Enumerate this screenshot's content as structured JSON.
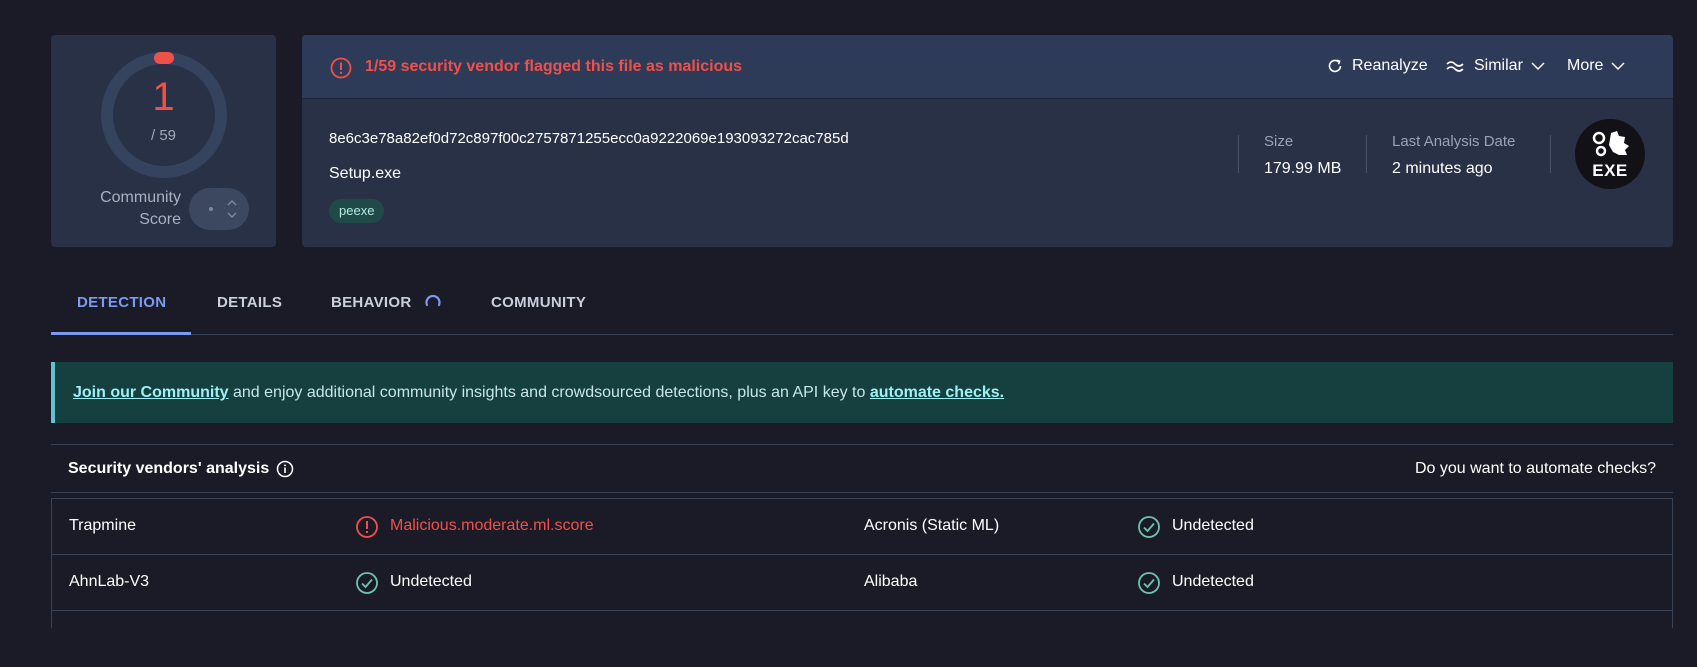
{
  "score": {
    "detections": "1",
    "total": "/ 59",
    "community_label_line1": "Community",
    "community_label_line2": "Score"
  },
  "file": {
    "alert": "1/59 security vendor flagged this file as malicious",
    "hash": "8e6c3e78a82ef0d72c897f00c2757871255ecc0a9222069e193093272cac785d",
    "name": "Setup.exe",
    "tag": "peexe",
    "size_label": "Size",
    "size_value": "179.99 MB",
    "date_label": "Last Analysis Date",
    "date_value": "2 minutes ago",
    "type_badge": "EXE"
  },
  "actions": {
    "reanalyze": "Reanalyze",
    "similar": "Similar",
    "more": "More"
  },
  "tabs": {
    "detection": "DETECTION",
    "details": "DETAILS",
    "behavior": "BEHAVIOR",
    "community": "COMMUNITY"
  },
  "banner": {
    "link1": "Join our Community",
    "text": " and enjoy additional community insights and crowdsourced detections, plus an API key to ",
    "link2": "automate checks."
  },
  "vendors": {
    "title": "Security vendors' analysis",
    "automate_prompt": "Do you want to automate checks?",
    "rows": [
      {
        "left_vendor": "Trapmine",
        "left_result": "Malicious.moderate.ml.score",
        "left_status": "malicious",
        "right_vendor": "Acronis (Static ML)",
        "right_result": "Undetected",
        "right_status": "undetected"
      },
      {
        "left_vendor": "AhnLab-V3",
        "left_result": "Undetected",
        "left_status": "undetected",
        "right_vendor": "Alibaba",
        "right_result": "Undetected",
        "right_status": "undetected"
      }
    ]
  },
  "colors": {
    "malicious": "#f0504a",
    "undetected": "#6dc3ae",
    "accent": "#7a9bf2"
  }
}
